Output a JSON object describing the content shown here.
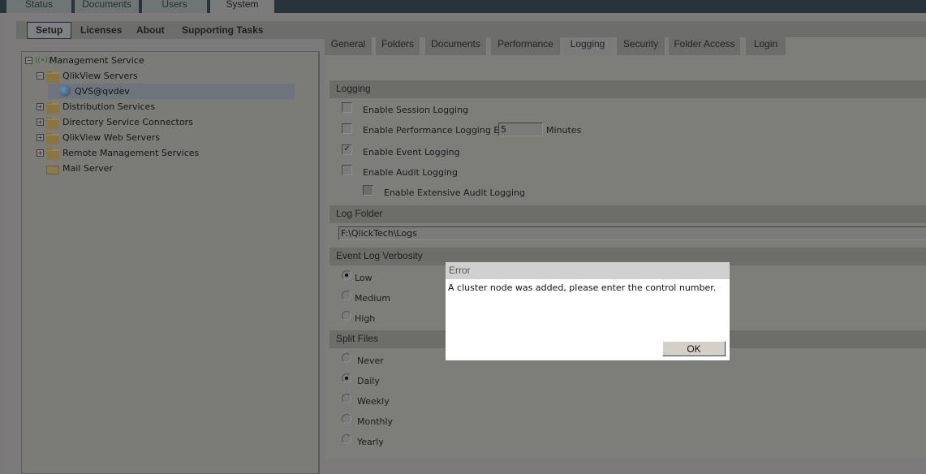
{
  "top_tabs": [
    {
      "label": "Status",
      "active": false
    },
    {
      "label": "Documents",
      "active": false
    },
    {
      "label": "Users",
      "active": false
    },
    {
      "label": "System",
      "active": true
    }
  ],
  "sub_nav": [
    {
      "label": "Setup",
      "active": true
    },
    {
      "label": "Licenses",
      "active": false
    },
    {
      "label": "About",
      "active": false
    },
    {
      "label": "Supporting Tasks",
      "active": false
    }
  ],
  "tree": {
    "root": {
      "label": "Management Service",
      "icon": "radio-signal-icon",
      "expanded": true
    },
    "items": [
      {
        "label": "QlikView Servers",
        "icon": "folder-icon",
        "expander": "minus"
      },
      {
        "label": "QVS@qvdev",
        "icon": "globe-icon",
        "selected": true
      },
      {
        "label": "Distribution Services",
        "icon": "folder-icon",
        "expander": "plus"
      },
      {
        "label": "Directory Service Connectors",
        "icon": "folder-icon",
        "expander": "plus"
      },
      {
        "label": "QlikView Web Servers",
        "icon": "folder-icon",
        "expander": "plus"
      },
      {
        "label": "Remote Management Services",
        "icon": "folder-icon",
        "expander": "plus"
      },
      {
        "label": "Mail Server",
        "icon": "mail-icon"
      }
    ]
  },
  "tabs": [
    {
      "label": "General",
      "active": false
    },
    {
      "label": "Folders",
      "active": false
    },
    {
      "label": "Documents",
      "active": false
    },
    {
      "label": "Performance",
      "active": false
    },
    {
      "label": "Logging",
      "active": true
    },
    {
      "label": "Security",
      "active": false
    },
    {
      "label": "Folder Access",
      "active": false
    },
    {
      "label": "Login",
      "active": false
    }
  ],
  "logging": {
    "header": "Logging",
    "session_logging": {
      "label": "Enable Session Logging",
      "checked": false
    },
    "performance_logging": {
      "label": "Enable Performance Logging Every",
      "checked": false,
      "value": "5",
      "unit": "Minutes"
    },
    "event_logging": {
      "label": "Enable Event Logging",
      "checked": true
    },
    "audit_logging": {
      "label": "Enable Audit Logging",
      "checked": false
    },
    "extensive_audit_logging": {
      "label": "Enable Extensive Audit Logging",
      "checked": false,
      "disabled": true
    }
  },
  "log_folder": {
    "header": "Log Folder",
    "value": "F:\\QlickTech\\Logs"
  },
  "verbosity": {
    "header": "Event Log Verbosity",
    "options": [
      {
        "label": "Low",
        "checked": true
      },
      {
        "label": "Medium",
        "checked": false
      },
      {
        "label": "High",
        "checked": false
      }
    ]
  },
  "split_files": {
    "header": "Split Files",
    "options": [
      {
        "label": "Never",
        "checked": false
      },
      {
        "label": "Daily",
        "checked": true
      },
      {
        "label": "Weekly",
        "checked": false
      },
      {
        "label": "Monthly",
        "checked": false
      },
      {
        "label": "Yearly",
        "checked": false
      }
    ]
  },
  "dialog": {
    "title": "Error",
    "message": "A cluster node was added, please enter the control number.",
    "ok_label": "OK"
  }
}
